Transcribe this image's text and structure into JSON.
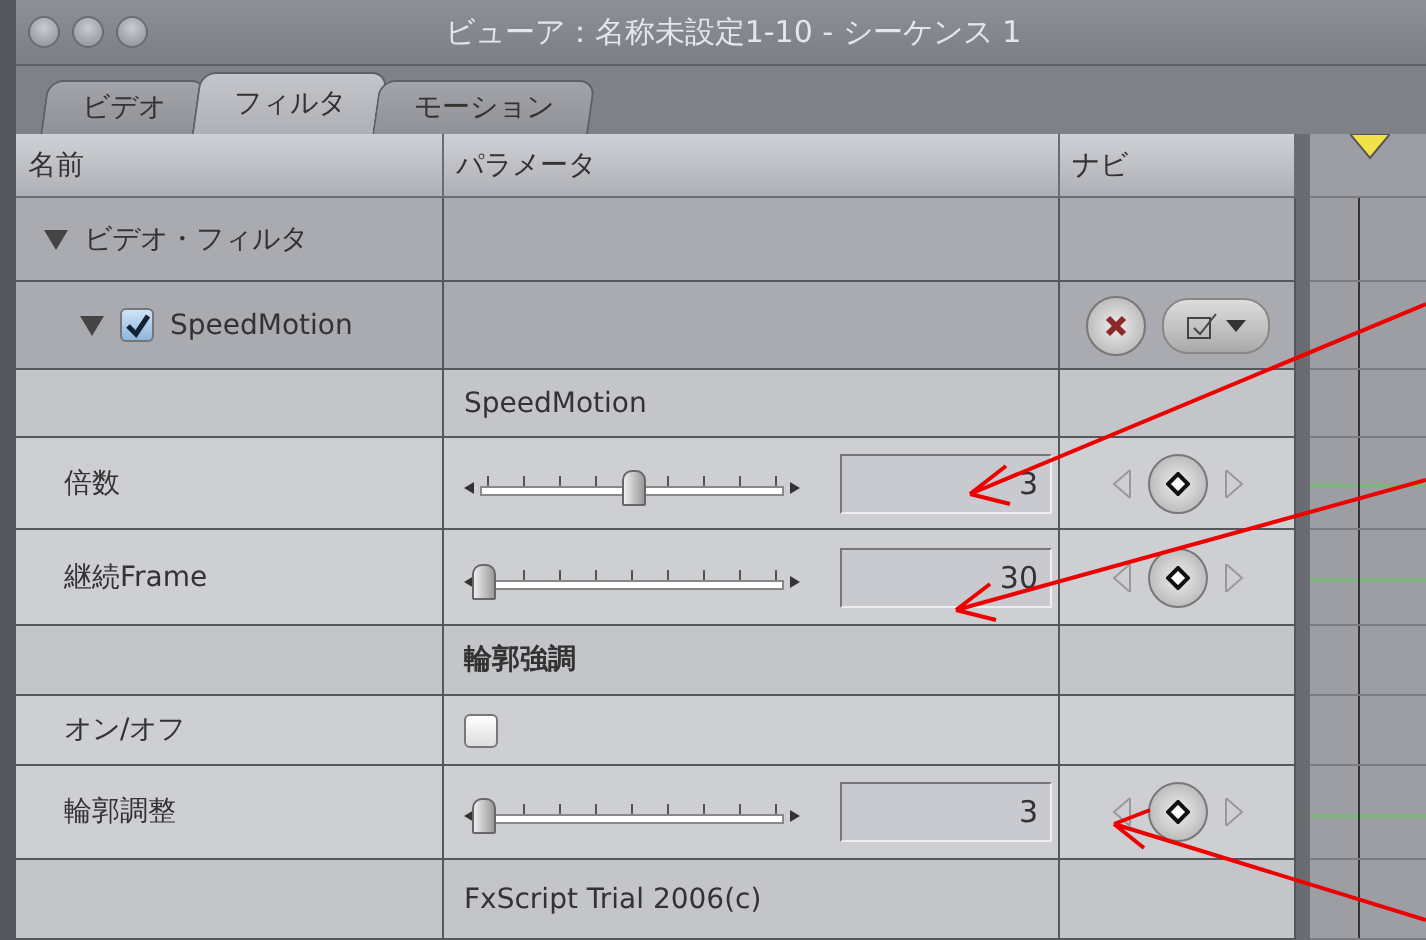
{
  "window": {
    "title": "ビューア：名称未設定1-10 - シーケンス 1"
  },
  "tabs": [
    {
      "label": "ビデオ",
      "selected": false
    },
    {
      "label": "フィルタ",
      "selected": true
    },
    {
      "label": "モーション",
      "selected": false
    }
  ],
  "columns": [
    "名前",
    "パラメータ",
    "ナビ"
  ],
  "rows": [
    {
      "kind": "group",
      "name": "ビデオ・フィルタ",
      "expanded": true
    },
    {
      "kind": "filter",
      "name": "SpeedMotion",
      "expanded": true,
      "checked": true
    },
    {
      "kind": "section",
      "title": "SpeedMotion"
    },
    {
      "kind": "slider",
      "name": "倍数",
      "level": 0.5,
      "value": "3"
    },
    {
      "kind": "slider",
      "name": "継続Frame",
      "level": 0,
      "value": "30"
    },
    {
      "kind": "section",
      "title": "輪郭強調",
      "bold": true
    },
    {
      "kind": "checkbox",
      "name": "オン/オフ",
      "checked": false
    },
    {
      "kind": "slider",
      "name": "輪郭調整",
      "level": 0,
      "value": "3"
    },
    {
      "kind": "section",
      "title": "FxScript Trial 2006(c)"
    }
  ]
}
